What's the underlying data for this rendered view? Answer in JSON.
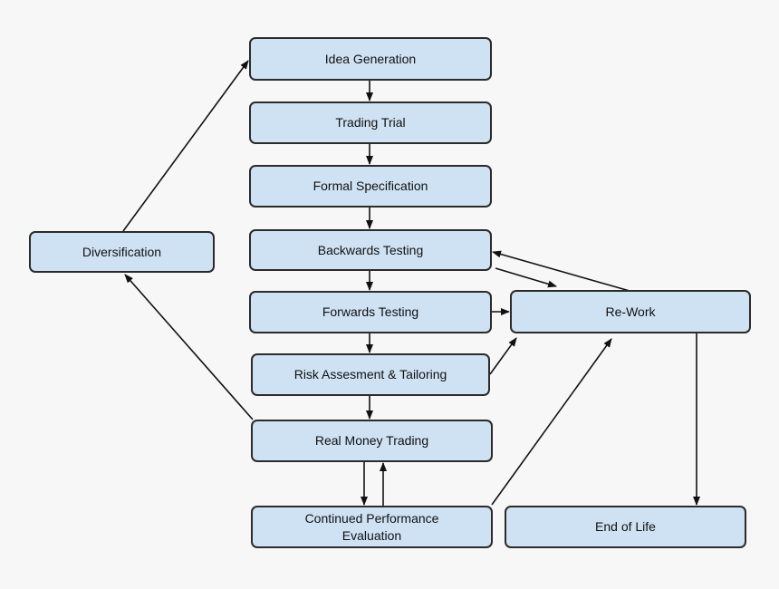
{
  "diagram": {
    "nodes": {
      "idea": "Idea Generation",
      "trial": "Trading Trial",
      "formal": "Formal Specification",
      "back": "Backwards Testing",
      "forward": "Forwards Testing",
      "risk": "Risk Assesment & Tailoring",
      "real": "Real Money Trading",
      "cont": "Continued Performance\nEvaluation",
      "div": "Diversification",
      "rework": "Re-Work",
      "eol": "End of Life"
    },
    "edges": [
      {
        "from": "idea",
        "to": "trial"
      },
      {
        "from": "trial",
        "to": "formal"
      },
      {
        "from": "formal",
        "to": "back"
      },
      {
        "from": "back",
        "to": "forward"
      },
      {
        "from": "forward",
        "to": "risk"
      },
      {
        "from": "risk",
        "to": "real"
      },
      {
        "from": "real",
        "to": "cont"
      },
      {
        "from": "cont",
        "to": "real"
      },
      {
        "from": "real",
        "to": "div"
      },
      {
        "from": "div",
        "to": "idea"
      },
      {
        "from": "back",
        "to": "rework"
      },
      {
        "from": "rework",
        "to": "back"
      },
      {
        "from": "forward",
        "to": "rework"
      },
      {
        "from": "risk",
        "to": "rework"
      },
      {
        "from": "cont",
        "to": "rework"
      },
      {
        "from": "rework",
        "to": "eol"
      }
    ],
    "colors": {
      "node_fill": "#cfe2f3",
      "node_border": "#2b2b2b",
      "edge": "#111111",
      "background": "#f7f7f7"
    }
  }
}
